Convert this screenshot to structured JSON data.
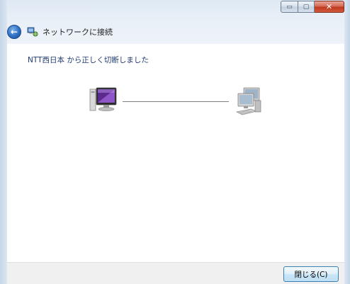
{
  "window": {
    "title": "ネットワークに接続",
    "back_icon": "back-arrow-icon",
    "title_icon": "network-connection-icon",
    "caption": {
      "minimize_glyph": "▭",
      "maximize_glyph": "▢",
      "close_glyph": "✕"
    }
  },
  "main": {
    "status_message": "NTT西日本 から正しく切断しました",
    "left_icon": "computer-icon",
    "right_icon": "network-computers-icon"
  },
  "footer": {
    "close_label": "閉じる(C)"
  },
  "colors": {
    "status_text": "#1f3a70",
    "close_caption": "#c0391f",
    "accent_border": "#3c7fb1"
  }
}
